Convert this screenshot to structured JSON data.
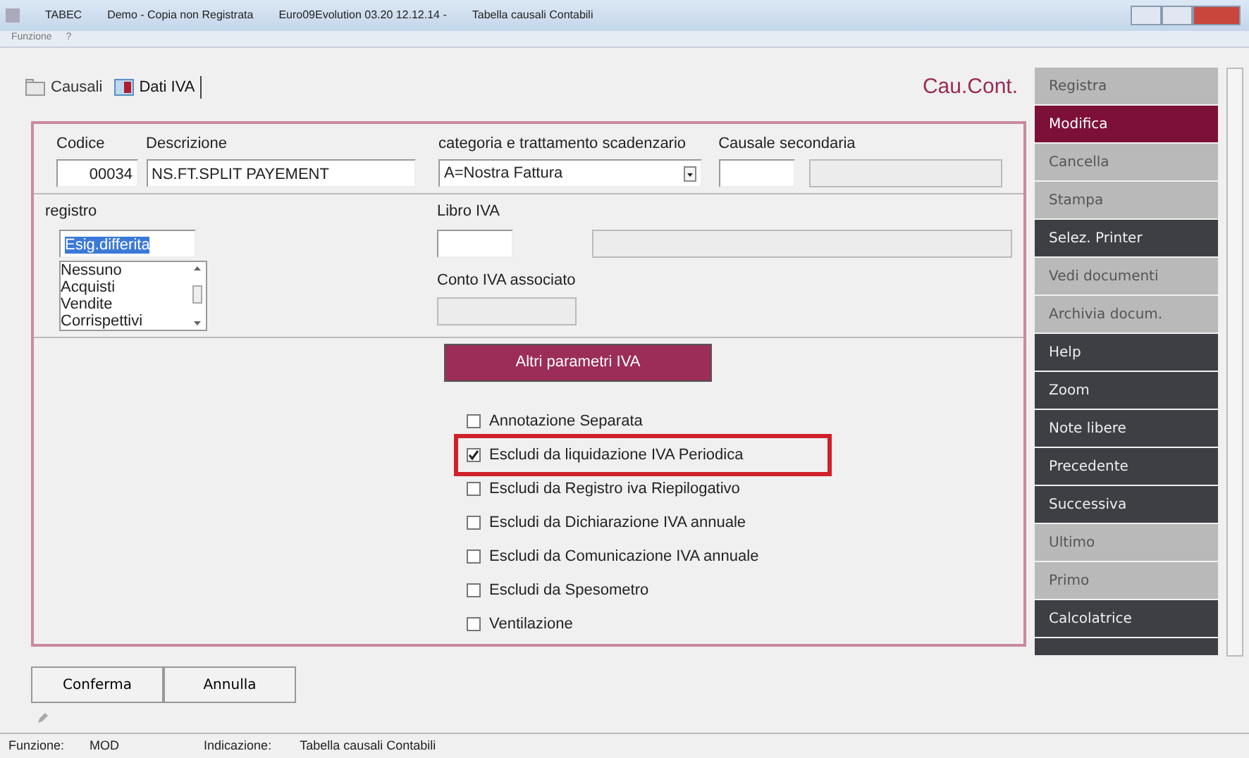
{
  "window": {
    "title_parts": [
      "TABEC",
      "Demo - Copia non Registrata",
      "Euro09Evolution 03.20 12.12.14 -",
      "Tabella causali Contabili"
    ]
  },
  "menu": [
    "Funzione",
    "?"
  ],
  "tabs": [
    {
      "label": "Causali",
      "selected": false,
      "kind": "folder"
    },
    {
      "label": "Dati IVA",
      "selected": true,
      "kind": "book"
    }
  ],
  "heading": "Cau.Cont.",
  "form": {
    "codice": {
      "label": "Codice",
      "value": "00034"
    },
    "descrizione": {
      "label": "Descrizione",
      "value": "NS.FT.SPLIT PAYEMENT"
    },
    "categoria": {
      "label": "categoria e trattamento scadenzario",
      "value": "A=Nostra Fattura"
    },
    "causale_secondaria": {
      "label": "Causale secondaria"
    },
    "registro": {
      "label": "registro",
      "value": "Esig.differita",
      "options": [
        "Nessuno",
        "Acquisti",
        "Vendite",
        "Corrispettivi"
      ]
    },
    "libro_iva": {
      "label": "Libro IVA"
    },
    "conto_iva": {
      "label": "Conto IVA associato"
    },
    "altri_button": "Altri parametri IVA",
    "options": [
      {
        "label": "Annotazione Separata",
        "checked": false,
        "highlighted": false
      },
      {
        "label": "Escludi da liquidazione IVA Periodica",
        "checked": true,
        "highlighted": true
      },
      {
        "label": "Escludi da Registro iva Riepilogativo",
        "checked": false,
        "highlighted": false
      },
      {
        "label": "Escludi da Dichiarazione IVA annuale",
        "checked": false,
        "highlighted": false
      },
      {
        "label": "Escludi da Comunicazione IVA annuale",
        "checked": false,
        "highlighted": false
      },
      {
        "label": "Escludi da Spesometro",
        "checked": false,
        "highlighted": false
      },
      {
        "label": "Ventilazione",
        "checked": false,
        "highlighted": false
      }
    ]
  },
  "sidebar": [
    {
      "label": "Registra",
      "selected": false,
      "disabled": true
    },
    {
      "label": "Modifica",
      "selected": true,
      "disabled": false
    },
    {
      "label": "Cancella",
      "selected": false,
      "disabled": true
    },
    {
      "label": "Stampa",
      "selected": false,
      "disabled": true
    },
    {
      "label": "Selez. Printer",
      "selected": false,
      "disabled": false
    },
    {
      "label": "Vedi documenti",
      "selected": false,
      "disabled": true
    },
    {
      "label": "Archivia docum.",
      "selected": false,
      "disabled": true
    },
    {
      "label": "Help",
      "selected": false,
      "disabled": false
    },
    {
      "label": "Zoom",
      "selected": false,
      "disabled": false
    },
    {
      "label": "Note libere",
      "selected": false,
      "disabled": false
    },
    {
      "label": "Precedente",
      "selected": false,
      "disabled": false
    },
    {
      "label": "Successiva",
      "selected": false,
      "disabled": false
    },
    {
      "label": "Ultimo",
      "selected": false,
      "disabled": true
    },
    {
      "label": "Primo",
      "selected": false,
      "disabled": true
    },
    {
      "label": "Calcolatrice",
      "selected": false,
      "disabled": false
    }
  ],
  "footer_buttons": [
    "Conferma",
    "Annulla"
  ],
  "status_bar": {
    "funzione_label": "Funzione:",
    "funzione_value": "MOD",
    "indicazione_label": "Indicazione:",
    "indicazione_value": "Tabella causali Contabili"
  }
}
